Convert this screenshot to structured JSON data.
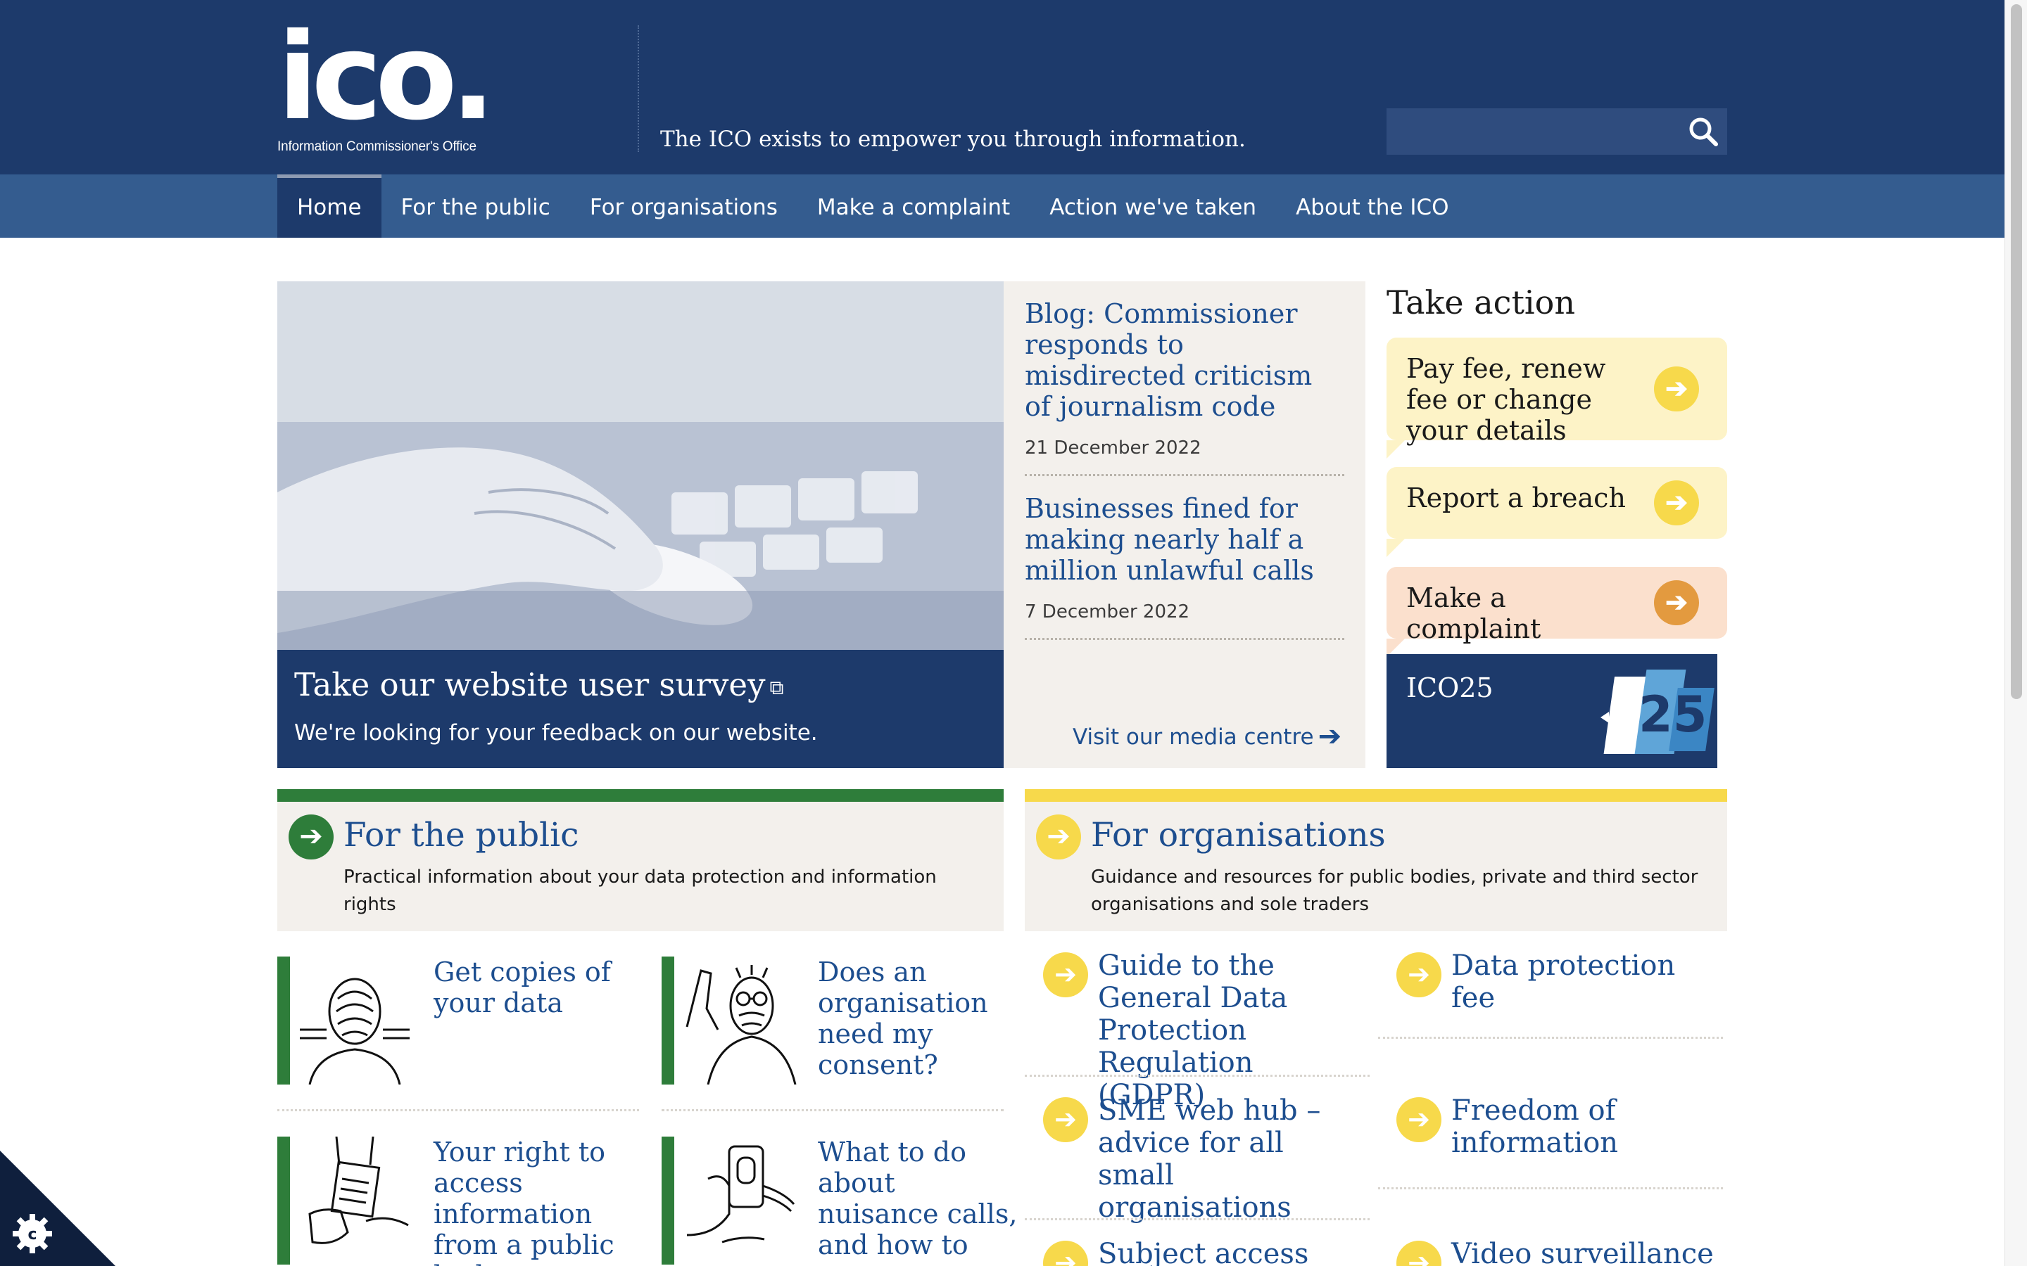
{
  "header": {
    "logo_word": "ico.",
    "logo_sub": "Information Commissioner's Office",
    "tagline": "The ICO exists to empower you through information.",
    "search_placeholder": ""
  },
  "nav": {
    "items": [
      {
        "label": "Home"
      },
      {
        "label": "For the public"
      },
      {
        "label": "For organisations"
      },
      {
        "label": "Make a complaint"
      },
      {
        "label": "Action we've taken"
      },
      {
        "label": "About the ICO"
      }
    ]
  },
  "hero": {
    "title": "Take our website user survey",
    "subtitle": "We're looking for your feedback on our website."
  },
  "news": {
    "items": [
      {
        "title": "Blog: Commissioner responds to misdirected criticism of journalism code",
        "date": "21 December 2022"
      },
      {
        "title": "Businesses fined for making nearly half a million unlawful calls",
        "date": "7 December 2022"
      }
    ],
    "media_link": "Visit our media centre"
  },
  "take_action": {
    "heading": "Take action",
    "cards": [
      {
        "label": "Pay fee, renew fee or change your details"
      },
      {
        "label": "Report a breach"
      },
      {
        "label": "Make a complaint"
      }
    ],
    "ico25_label": "ICO25",
    "ico25_badge": "25"
  },
  "public": {
    "title": "For the public",
    "description": "Practical information about your data protection and information rights",
    "tiles": [
      {
        "label": "Get copies of your data"
      },
      {
        "label": "Does an organisation need my consent?"
      },
      {
        "label": "Your right to access information from a public body"
      },
      {
        "label": "What to do about nuisance calls, and how to protect yourself"
      }
    ]
  },
  "organisations": {
    "title": "For organisations",
    "description": "Guidance and resources for public bodies, private and third sector organisations and sole traders",
    "tiles": [
      {
        "label": "Guide to the General Data Protection Regulation (GDPR)"
      },
      {
        "label": "Data protection fee"
      },
      {
        "label": "SME web hub – advice for all small organisations"
      },
      {
        "label": "Freedom of information"
      },
      {
        "label": "Subject access requests"
      },
      {
        "label": "Video surveillance"
      }
    ]
  },
  "colors": {
    "navy": "#1d3a6b",
    "nav_blue": "#345c8f",
    "link_blue": "#1d4e8f",
    "public_green": "#2e7d3a",
    "org_yellow": "#f7d94b",
    "complaint_orange": "#e39a3f",
    "panel_beige": "#f3f0ec"
  }
}
